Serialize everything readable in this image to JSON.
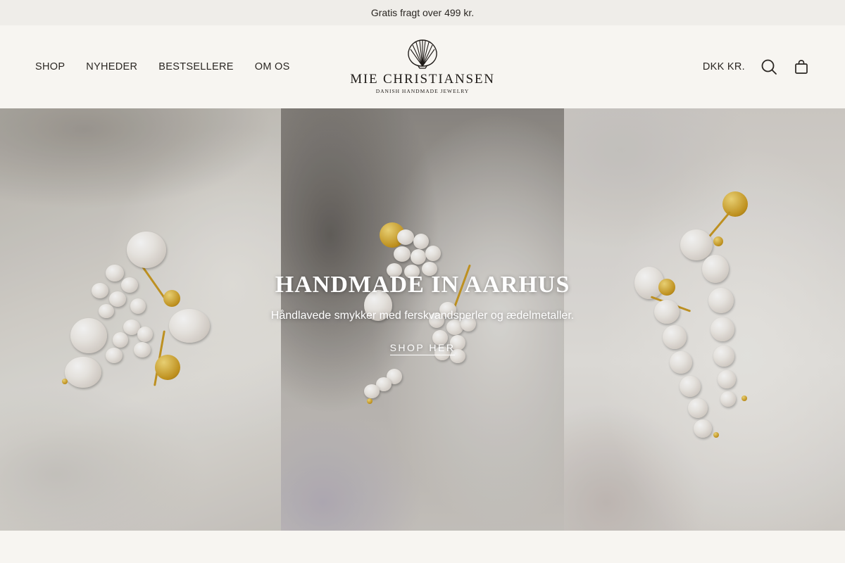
{
  "announcement": {
    "text": "Gratis fragt over 499 kr."
  },
  "nav": {
    "items": [
      {
        "label": "SHOP"
      },
      {
        "label": "NYHEDER"
      },
      {
        "label": "BESTSELLERE"
      },
      {
        "label": "OM OS"
      }
    ]
  },
  "logo": {
    "name": "MIE CHRISTIANSEN",
    "tagline": "DANISH HANDMADE JEWELRY",
    "icon": "shell-icon"
  },
  "header_right": {
    "currency": "DKK KR.",
    "search_icon": "search-icon",
    "cart_icon": "bag-icon"
  },
  "hero": {
    "title": "HANDMADE IN AARHUS",
    "subtitle": "Håndlavede smykker med ferskvandsperler og ædelmetaller.",
    "cta": "SHOP HER"
  },
  "colors": {
    "background": "#f7f5f1",
    "announcement_bg": "#efede9",
    "text": "#2a2622"
  }
}
